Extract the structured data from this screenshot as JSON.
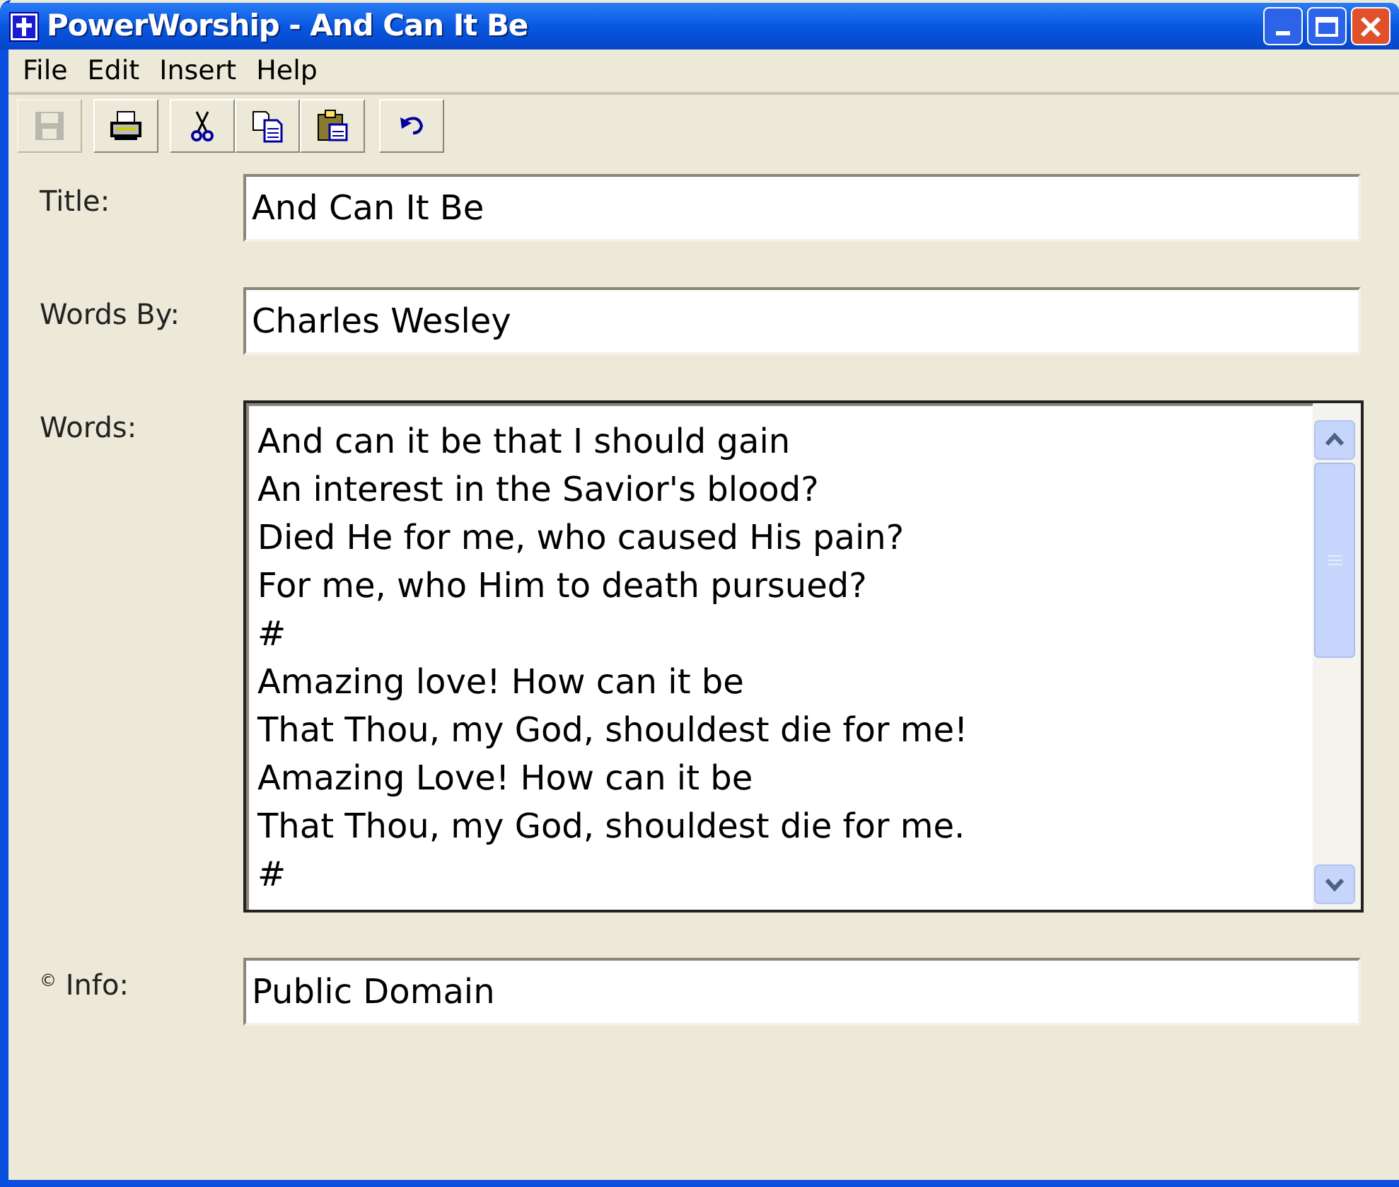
{
  "window": {
    "title": "PowerWorship - And Can It Be"
  },
  "menu": [
    "File",
    "Edit",
    "Insert",
    "Help"
  ],
  "toolbar": [
    {
      "kind": "save",
      "disabled": true
    },
    {
      "kind": "print",
      "disabled": false
    },
    {
      "kind": "cut",
      "disabled": false
    },
    {
      "kind": "copy",
      "disabled": false
    },
    {
      "kind": "paste",
      "disabled": false
    },
    {
      "kind": "undo",
      "disabled": false
    }
  ],
  "fields": [
    {
      "kind": "line",
      "label": "Title:",
      "value": "And Can It Be"
    },
    {
      "kind": "line",
      "label": "Words By:",
      "value": "Charles Wesley"
    },
    {
      "kind": "multiline",
      "label": "Words:",
      "lines": [
        "And can it be that I should gain",
        "An interest in the Savior's blood?",
        "Died He for me, who caused His pain?",
        "For me, who Him to death pursued?",
        "#",
        "Amazing love! How can it be",
        "That Thou, my God, shouldest die for me!",
        "Amazing Love! How can it be",
        "That Thou, my God, shouldest die for me.",
        "#"
      ]
    },
    {
      "kind": "line",
      "label": "$^{©}$ Info:",
      "value": "Public Domain"
    }
  ]
}
